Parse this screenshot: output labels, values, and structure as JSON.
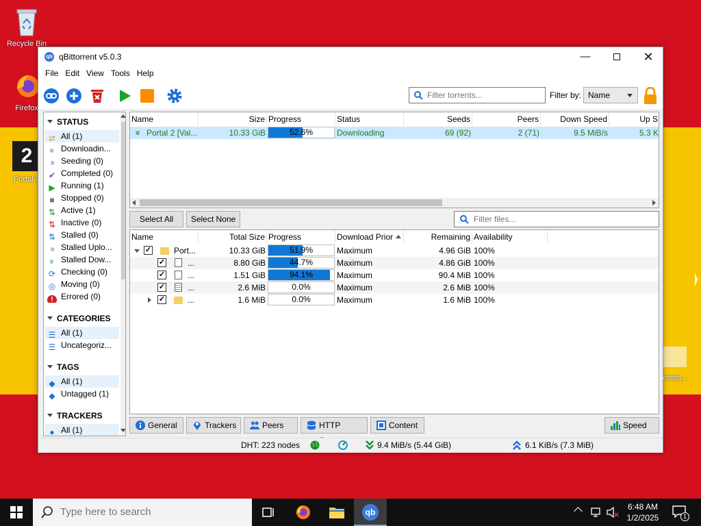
{
  "desktop": {
    "icons": [
      {
        "label": "Recycle Bin"
      },
      {
        "label": "Firefox"
      },
      {
        "label": "Portal 2"
      },
      {
        "label": "testea..."
      }
    ]
  },
  "window": {
    "title": "qBittorrent v5.0.3",
    "app_icon": "qb",
    "menu": [
      "File",
      "Edit",
      "View",
      "Tools",
      "Help"
    ],
    "toolbar": {
      "filter_placeholder": "Filter torrents...",
      "filter_by_label": "Filter by:",
      "filter_by_value": "Name"
    }
  },
  "sidebar": {
    "status_header": "STATUS",
    "status": [
      {
        "label": "All (1)",
        "icon": "shuffle-icon",
        "color": "#d89b1f"
      },
      {
        "label": "Downloadin...",
        "icon": "double-chevron-down-icon",
        "color": "#1f8f2a"
      },
      {
        "label": "Seeding (0)",
        "icon": "double-chevron-up-icon",
        "color": "#2b6fd6"
      },
      {
        "label": "Completed (0)",
        "icon": "checkmark-icon",
        "color": "#7a3fc4"
      },
      {
        "label": "Running (1)",
        "icon": "play-icon",
        "color": "#1f9e2a"
      },
      {
        "label": "Stopped (0)",
        "icon": "stop-square-icon",
        "color": "#777777"
      },
      {
        "label": "Active (1)",
        "icon": "updown-arrows-icon",
        "color": "#1f8f2a"
      },
      {
        "label": "Inactive (0)",
        "icon": "updown-arrows-icon",
        "color": "#d22020"
      },
      {
        "label": "Stalled (0)",
        "icon": "updown-arrows-icon",
        "color": "#2b6fd6"
      },
      {
        "label": "Stalled Uplo...",
        "icon": "double-chevron-up-icon",
        "color": "#2b6fd6"
      },
      {
        "label": "Stalled Dow...",
        "icon": "double-chevron-down-icon",
        "color": "#1f8f2a"
      },
      {
        "label": "Checking (0)",
        "icon": "refresh-icon",
        "color": "#1f6fd0"
      },
      {
        "label": "Moving (0)",
        "icon": "target-icon",
        "color": "#2b6fd6"
      },
      {
        "label": "Errored (0)",
        "icon": "error-icon",
        "color": "#d22020"
      }
    ],
    "categories_header": "CATEGORIES",
    "categories": [
      {
        "label": "All (1)",
        "icon": "list-icon"
      },
      {
        "label": "Uncategoriz...",
        "icon": "list-icon"
      }
    ],
    "tags_header": "TAGS",
    "tags": [
      {
        "label": "All (1)",
        "icon": "tag-icon"
      },
      {
        "label": "Untagged (1)",
        "icon": "tag-icon"
      }
    ],
    "trackers_header": "TRACKERS",
    "trackers": [
      {
        "label": "All (1)",
        "icon": "location-pin-icon"
      }
    ]
  },
  "torrents": {
    "columns": [
      "Name",
      "Size",
      "Progress",
      "Status",
      "Seeds",
      "Peers",
      "Down Speed",
      "Up S"
    ],
    "rows": [
      {
        "name": "Portal 2 [Val...",
        "size": "10.33 GiB",
        "progress_text": "52.6%",
        "progress": 0.526,
        "status": "Downloading",
        "seeds": "69 (92)",
        "peers": "2 (71)",
        "down": "9.5 MiB/s",
        "up": "5.3 K"
      }
    ]
  },
  "files": {
    "select_all": "Select All",
    "select_none": "Select None",
    "filter_placeholder": "Filter files...",
    "columns": [
      "Name",
      "Total Size",
      "Progress",
      "Download Prior",
      "Remaining",
      "Availability"
    ],
    "rows": [
      {
        "name": "Port...",
        "size": "10.33 GiB",
        "progress_text": "51.9%",
        "progress": 0.519,
        "priority": "Maximum",
        "remaining": "4.96 GiB",
        "availability": "100%"
      },
      {
        "name": "...",
        "size": "8.80 GiB",
        "progress_text": "44.7%",
        "progress": 0.447,
        "priority": "Maximum",
        "remaining": "4.86 GiB",
        "availability": "100%"
      },
      {
        "name": "...",
        "size": "1.51 GiB",
        "progress_text": "94.1%",
        "progress": 0.941,
        "priority": "Maximum",
        "remaining": "90.4 MiB",
        "availability": "100%"
      },
      {
        "name": "...",
        "size": "2.6 MiB",
        "progress_text": "0.0%",
        "progress": 0,
        "priority": "Maximum",
        "remaining": "2.6 MiB",
        "availability": "100%"
      },
      {
        "name": "...",
        "size": "1.6 MiB",
        "progress_text": "0.0%",
        "progress": 0,
        "priority": "Maximum",
        "remaining": "1.6 MiB",
        "availability": "100%"
      }
    ]
  },
  "tabs": [
    "General",
    "Trackers",
    "Peers",
    "HTTP Sources",
    "Content"
  ],
  "speed_button": "Speed",
  "statusbar": {
    "dht": "DHT: 223 nodes",
    "down": "9.4 MiB/s (5.44 GiB)",
    "up": "6.1 KiB/s (7.3 MiB)"
  },
  "taskbar": {
    "search_placeholder": "Type here to search",
    "time": "6:48 AM",
    "date": "1/2/2025",
    "notification_count": "1"
  }
}
